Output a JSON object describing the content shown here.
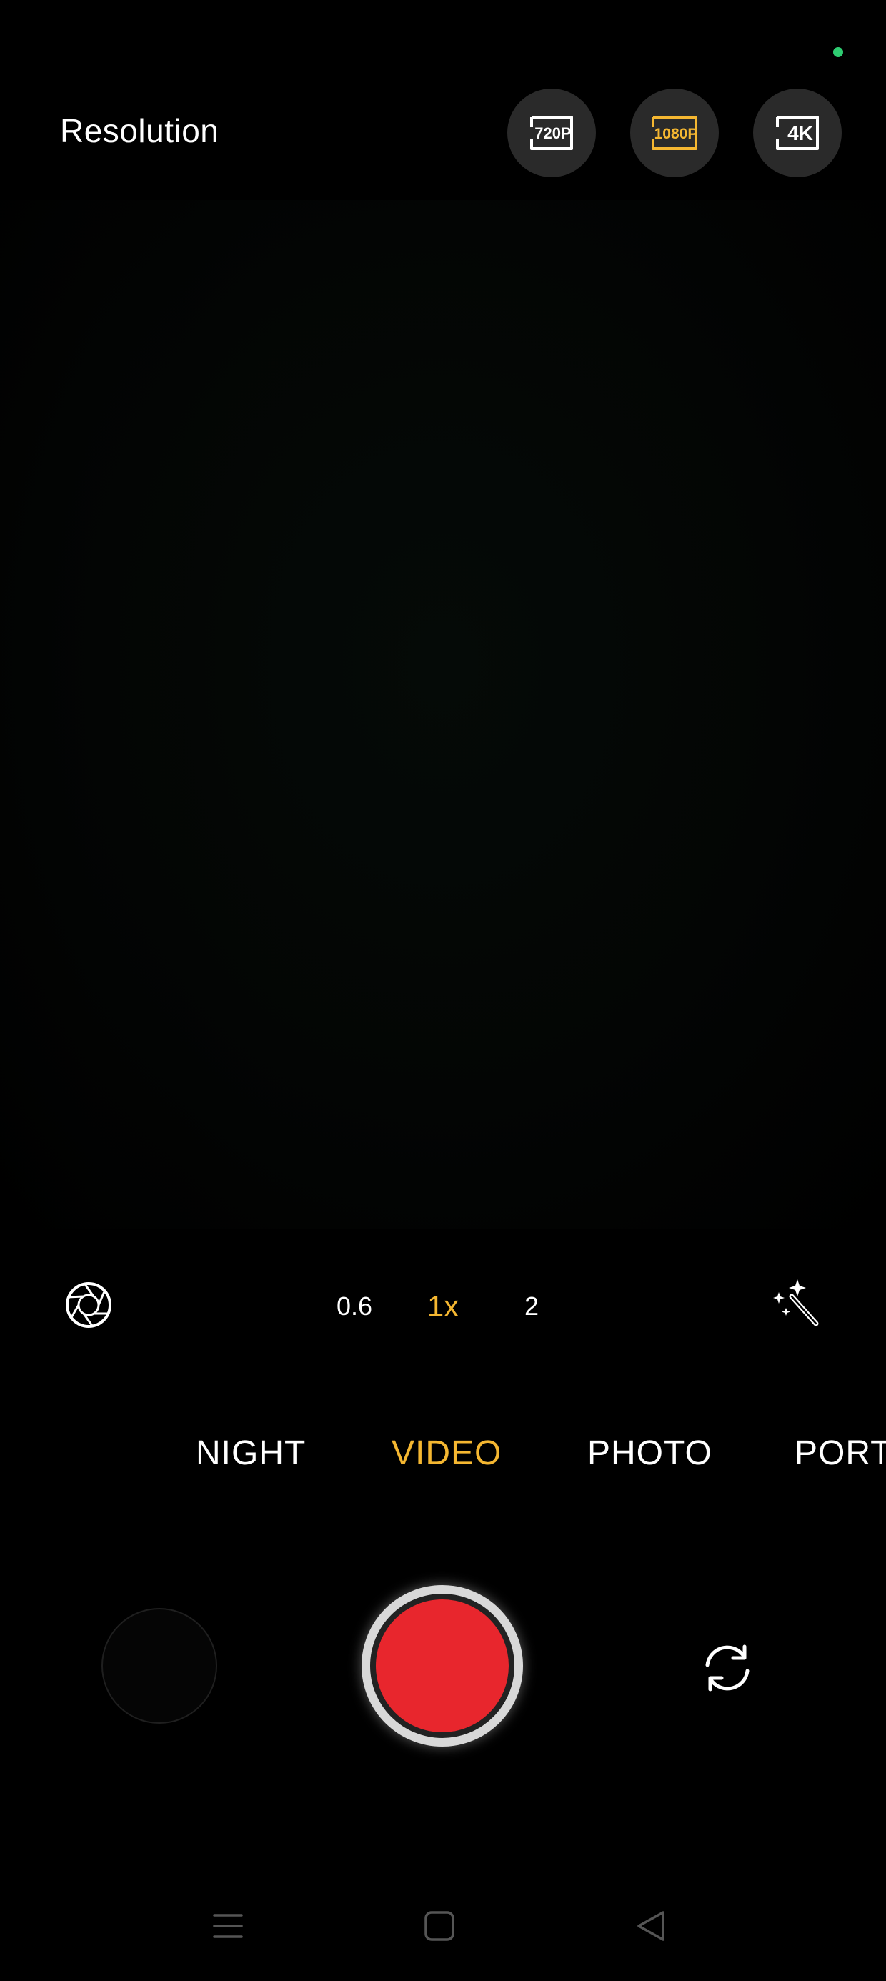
{
  "status": {
    "privacy_indicator_color": "#2ecc71"
  },
  "resolution": {
    "title": "Resolution",
    "options": [
      {
        "label": "720P",
        "icon": "hd-720p-icon",
        "selected": false
      },
      {
        "label": "1080P",
        "icon": "hd-1080p-icon",
        "selected": true
      },
      {
        "label": "4K",
        "icon": "uhd-4k-icon",
        "selected": false
      }
    ]
  },
  "tools": {
    "left_icon": "aperture-icon",
    "right_icon": "magic-wand-icon"
  },
  "zoom": {
    "levels": [
      "0.6",
      "1x",
      "2"
    ],
    "selected": "1x"
  },
  "modes": {
    "items": [
      "NIGHT",
      "VIDEO",
      "PHOTO",
      "PORT"
    ],
    "selected": "VIDEO"
  },
  "controls": {
    "gallery_icon": "gallery-thumbnail",
    "shutter_icon": "record-button",
    "switch_icon": "switch-camera-icon"
  },
  "navbar": {
    "recent_icon": "menu-icon",
    "home_icon": "home-square-icon",
    "back_icon": "back-triangle-icon"
  },
  "colors": {
    "accent": "#f5b731",
    "record": "#e8262d",
    "background": "#000000"
  }
}
